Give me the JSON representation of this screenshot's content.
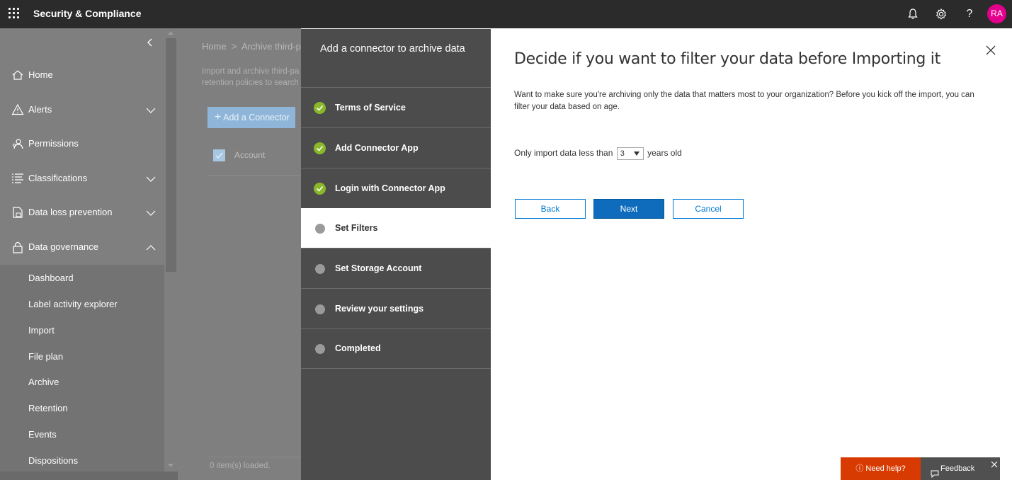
{
  "topbar": {
    "app_title": "Security & Compliance",
    "avatar_initials": "RA",
    "avatar_color": "#e3008c",
    "icons": [
      "waffle-icon",
      "bell-icon",
      "gear-icon",
      "help-icon"
    ]
  },
  "sidebar": {
    "items": [
      {
        "label": "Home",
        "icon": "home-icon"
      },
      {
        "label": "Alerts",
        "icon": "alert-icon",
        "expandable": true
      },
      {
        "label": "Permissions",
        "icon": "permissions-icon"
      },
      {
        "label": "Classifications",
        "icon": "classifications-icon",
        "expandable": true
      },
      {
        "label": "Data loss prevention",
        "icon": "dlp-icon",
        "expandable": true
      },
      {
        "label": "Data governance",
        "icon": "lock-icon",
        "expanded": true
      }
    ],
    "sub_items": [
      "Dashboard",
      "Label activity explorer",
      "Import",
      "File plan",
      "Archive",
      "Retention",
      "Events",
      "Dispositions"
    ]
  },
  "background_page": {
    "breadcrumb": [
      "Home",
      ">",
      "Archive third-pa"
    ],
    "description_lines": [
      "Import and archive third-pa",
      "retention policies to search"
    ],
    "add_connector_label": "Add a Connector",
    "column_account": "Account",
    "items_loaded": "0 item(s) loaded."
  },
  "wizard": {
    "title": "Add a connector to archive data",
    "steps": [
      {
        "label": "Terms of Service",
        "state": "done"
      },
      {
        "label": "Add Connector App",
        "state": "done"
      },
      {
        "label": "Login with Connector App",
        "state": "done"
      },
      {
        "label": "Set Filters",
        "state": "active"
      },
      {
        "label": "Set Storage Account",
        "state": "pending"
      },
      {
        "label": "Review your settings",
        "state": "pending"
      },
      {
        "label": "Completed",
        "state": "pending"
      }
    ]
  },
  "content": {
    "heading": "Decide if you want to filter your data before Importing it",
    "intro_line1": "Want to make sure you're archiving only the data that matters most to your organization? Before you kick off the import, you can",
    "intro_line2": "filter your data based on age.",
    "filter_prefix": "Only import data less than",
    "filter_value": "3",
    "filter_suffix": "years old",
    "back_label": "Back",
    "next_label": "Next",
    "cancel_label": "Cancel"
  },
  "helpbar": {
    "need_help": "Need help?",
    "feedback": "Feedback"
  },
  "colors": {
    "accent": "#0078d4",
    "done_green": "#8ab82a",
    "help_orange": "#d83b01"
  }
}
